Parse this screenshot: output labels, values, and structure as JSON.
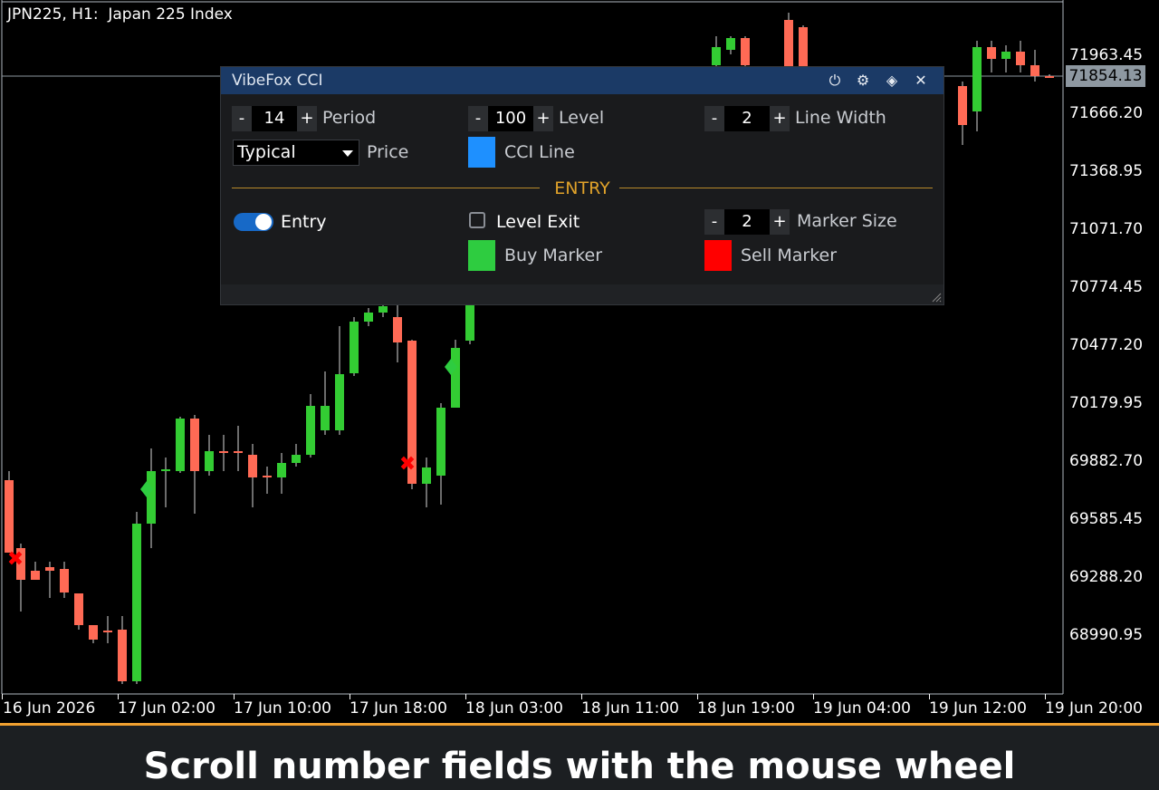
{
  "chart": {
    "symbol_title": "JPN225, H1:  Japan 225 Index",
    "current_price": "71854.13",
    "price_axis": [
      "71963.45",
      "71666.20",
      "71368.95",
      "71071.70",
      "70774.45",
      "70477.20",
      "70179.95",
      "69882.70",
      "69585.45",
      "69288.20",
      "68990.95"
    ],
    "time_axis": [
      "16 Jun 2026",
      "17 Jun 02:00",
      "17 Jun 10:00",
      "17 Jun 18:00",
      "18 Jun 03:00",
      "18 Jun 11:00",
      "18 Jun 19:00",
      "19 Jun 04:00",
      "19 Jun 12:00",
      "19 Jun 20:00"
    ],
    "colors": {
      "bull": "#33cc33",
      "bear": "#ff6a55",
      "buy_marker": "#2ecc40",
      "sell_marker": "#ff0000",
      "grid_line": "#b0b8c0"
    }
  },
  "panel": {
    "title": "VibeFox CCI",
    "header_icons": [
      "power-icon",
      "gear-icon",
      "diamond-arrows-icon",
      "close-icon"
    ],
    "header_glyphs": [
      "⏻",
      "⚙",
      "◈",
      "✕"
    ],
    "period": {
      "minus": "-",
      "value": "14",
      "plus": "+",
      "label": "Period"
    },
    "level": {
      "minus": "-",
      "value": "100",
      "plus": "+",
      "label": "Level"
    },
    "line_width": {
      "minus": "-",
      "value": "2",
      "plus": "+",
      "label": "Line Width"
    },
    "price": {
      "value": "Typical",
      "label": "Price"
    },
    "cci_line": {
      "label": "CCI Line",
      "color": "#1e90ff"
    },
    "section_entry": "ENTRY",
    "entry_toggle": {
      "label": "Entry",
      "on": true
    },
    "level_exit": {
      "label": "Level Exit",
      "checked": false
    },
    "marker_size": {
      "minus": "-",
      "value": "2",
      "plus": "+",
      "label": "Marker Size"
    },
    "buy_marker": {
      "label": "Buy Marker",
      "color": "#2ecc40"
    },
    "sell_marker": {
      "label": "Sell Marker",
      "color": "#ff0000"
    }
  },
  "banner": {
    "text": "Scroll number fields with the mouse wheel"
  }
}
